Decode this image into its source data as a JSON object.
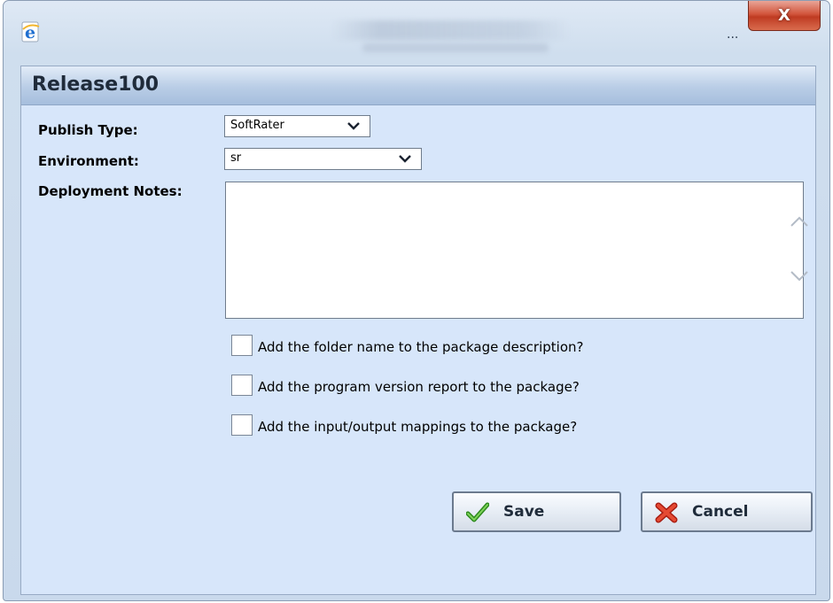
{
  "window": {
    "close_label": "X",
    "overflow_label": "...",
    "icon": "ie-icon"
  },
  "dialog": {
    "title": "Release100"
  },
  "form": {
    "publish_type": {
      "label": "Publish Type:",
      "value": "SoftRater"
    },
    "environment": {
      "label": "Environment:",
      "value": "sr"
    },
    "deployment_notes": {
      "label": "Deployment Notes:",
      "value": ""
    }
  },
  "options": [
    {
      "label": "Add the folder name to the package description?",
      "checked": false
    },
    {
      "label": "Add the program version report to the package?",
      "checked": false
    },
    {
      "label": "Add the input/output mappings to the package?",
      "checked": false
    }
  ],
  "buttons": {
    "save": {
      "label": "Save",
      "icon": "checkmark-icon"
    },
    "cancel": {
      "label": "Cancel",
      "icon": "red-x-icon"
    }
  },
  "colors": {
    "panel_bg": "#d7e6fa",
    "header_bar": "#b9cde6",
    "close_button": "#d2553c"
  }
}
